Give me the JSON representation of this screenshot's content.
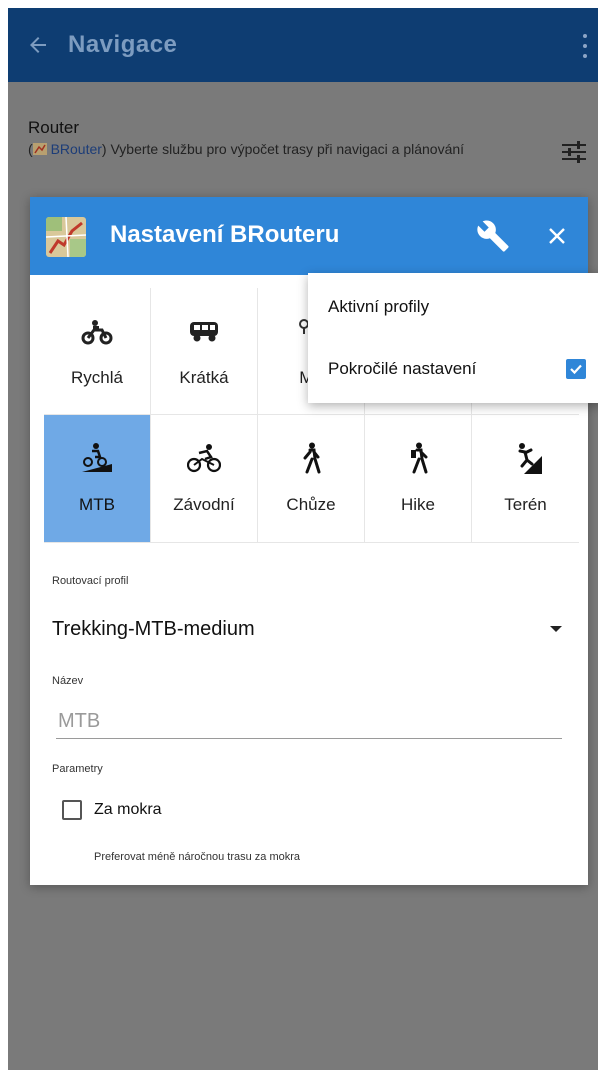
{
  "appbar": {
    "title": "Navigace"
  },
  "router": {
    "title": "Router",
    "desc_prefix": "(",
    "link": "BRouter",
    "desc_rest": ") Vyberte službu pro výpočet trasy při navigaci a plánování"
  },
  "dialog": {
    "title": "Nastavení BRouteru",
    "profiles_row1": [
      {
        "label": "Rychlá",
        "icon": "motorcycle-icon"
      },
      {
        "label": "Krátká",
        "icon": "van-icon"
      },
      {
        "label": "Mo",
        "icon": "moped-icon"
      },
      {
        "label": "",
        "icon": ""
      },
      {
        "label": "",
        "icon": ""
      }
    ],
    "profiles_row2": [
      {
        "label": "MTB",
        "icon": "mtb-icon",
        "active": true
      },
      {
        "label": "Závodní",
        "icon": "road-bike-icon"
      },
      {
        "label": "Chůze",
        "icon": "walking-icon"
      },
      {
        "label": "Hike",
        "icon": "hiking-icon"
      },
      {
        "label": "Terén",
        "icon": "climbing-icon"
      }
    ],
    "routing_profile_label": "Routovací profil",
    "routing_profile_value": "Trekking-MTB-medium",
    "name_label": "Název",
    "name_placeholder": "MTB",
    "params_label": "Parametry",
    "wet_checkbox_label": "Za mokra",
    "wet_checkbox_checked": false,
    "wet_hint": "Preferovat méně náročnou trasu za mokra"
  },
  "popup_menu": {
    "items": [
      {
        "label": "Aktivní profily"
      },
      {
        "label": "Pokročilé nastavení",
        "checked": true
      }
    ]
  },
  "colors": {
    "appbar": "#0e3d72",
    "dialog_header": "#2f86d8",
    "active_cell": "#6fa9e6",
    "scrim": "#7a7a7a"
  }
}
